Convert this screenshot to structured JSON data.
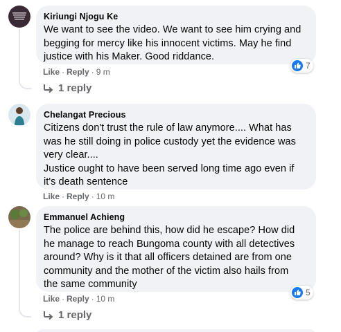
{
  "comments": [
    {
      "author": "Kiriungi Njogu Ke",
      "text": "We want to see the video. We want to see him crying and\nbegging for mercy like his innocent victims. May he find\njustice with his Maker. Good riddance.",
      "like_label": "Like",
      "reply_label": "Reply",
      "time": "9 m",
      "reaction_count": "7",
      "replies_label": "1 reply"
    },
    {
      "author": "Chelangat Precious",
      "text": "Citizens don't trust the rule of law anymore.... What has\nwas he still doing in police custody yet the evidence was\nvery clear....\nJustice ought to have been served long time ago even if\nit's death sentence",
      "like_label": "Like",
      "reply_label": "Reply",
      "time": "10 m"
    },
    {
      "author": "Emmanuel Achieng",
      "text": "The police are behind this, how did he escape? How did\nhe manage to reach Bungoma county with all detectives\naround? Why is it that all officers detained are from one\ncommunity and the mother of the victim also hails from\nthe same community",
      "like_label": "Like",
      "reply_label": "Reply",
      "time": "10 m",
      "reaction_count": "5",
      "replies_label": "1 reply"
    }
  ],
  "colors": {
    "bubble": "#f0f2f5",
    "text": "#050505",
    "secondary": "#65676b",
    "like_blue": "#1877f2"
  }
}
